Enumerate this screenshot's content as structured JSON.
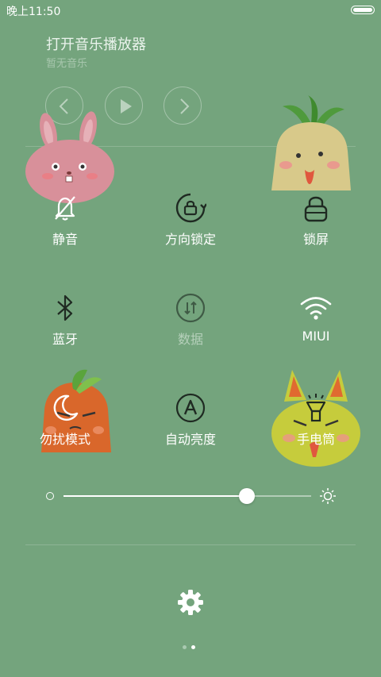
{
  "status_bar": {
    "time": "晚上11:50",
    "battery_level": 1.0
  },
  "music": {
    "title": "打开音乐播放器",
    "subtitle": "暂无音乐"
  },
  "icons": {
    "prev": "chevron-left-icon",
    "play": "play-icon",
    "next": "chevron-right-icon",
    "settings": "gear-icon"
  },
  "tiles": [
    {
      "id": "mute",
      "label": "静音",
      "icon": "bell-off-icon",
      "active": true
    },
    {
      "id": "rotation-lock",
      "label": "方向锁定",
      "icon": "rotation-lock-icon",
      "active": true
    },
    {
      "id": "lock-screen",
      "label": "锁屏",
      "icon": "lock-icon",
      "active": true
    },
    {
      "id": "bluetooth",
      "label": "蓝牙",
      "icon": "bluetooth-icon",
      "active": true
    },
    {
      "id": "data",
      "label": "数据",
      "icon": "data-arrows-icon",
      "active": false
    },
    {
      "id": "wifi",
      "label": "MIUI",
      "icon": "wifi-icon",
      "active": true
    },
    {
      "id": "dnd",
      "label": "勿扰模式",
      "icon": "moon-icon",
      "active": true
    },
    {
      "id": "auto-brightness",
      "label": "自动亮度",
      "icon": "auto-brightness-icon",
      "active": true
    },
    {
      "id": "flashlight",
      "label": "手电筒",
      "icon": "flashlight-icon",
      "active": true
    }
  ],
  "brightness": {
    "level": 0.74
  },
  "pager": {
    "count": 2,
    "current": 1
  },
  "colors": {
    "background": "#74a47d",
    "dot_active": "#ffffff",
    "dot_inactive": "#a9c9b0"
  }
}
